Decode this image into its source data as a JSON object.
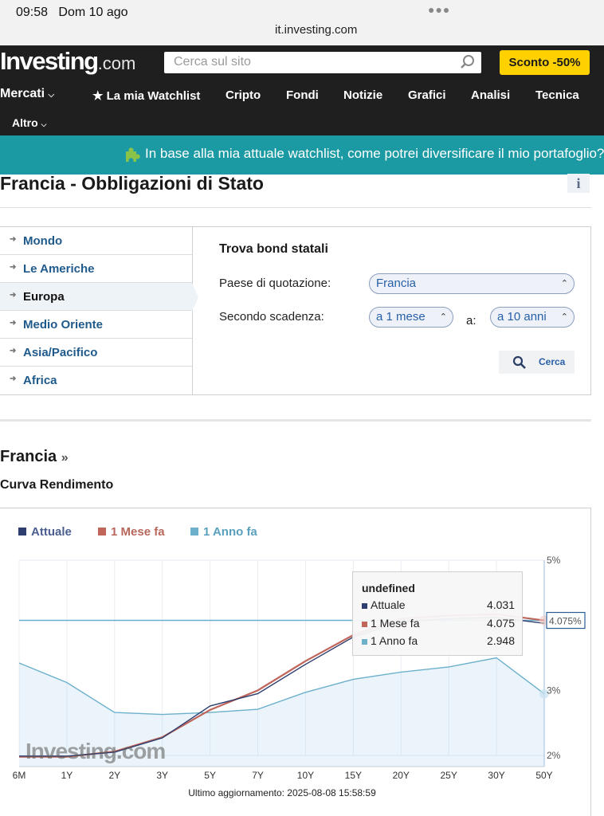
{
  "status": {
    "time": "09:58",
    "date": "Dom 10 ago",
    "url": "it.investing.com"
  },
  "header": {
    "logo_main": "Investing",
    "logo_com": ".com",
    "search_placeholder": "Cerca sul sito",
    "promo": "Sconto -50%"
  },
  "nav": {
    "items": [
      "Mercati",
      "La mia Watchlist",
      "Cripto",
      "Fondi",
      "Notizie",
      "Grafici",
      "Analisi",
      "Tecnica",
      "Altro"
    ]
  },
  "banner": {
    "text": "In base alla mia attuale watchlist, come potrei diversificare il mio portafoglio?"
  },
  "page": {
    "title": "Francia - Obbligazioni di Stato",
    "info": "i"
  },
  "regions": [
    "Mondo",
    "Le Americhe",
    "Europa",
    "Medio Oriente",
    "Asia/Pacifico",
    "Africa"
  ],
  "active_region": "Europa",
  "finder": {
    "title": "Trova bond statali",
    "country_label": "Paese di quotazione:",
    "country_value": "Francia",
    "maturity_label": "Secondo scadenza:",
    "from_value": "a 1 mese",
    "to_label": "a:",
    "to_value": "a 10 anni",
    "search_button": "Cerca"
  },
  "section": {
    "title": "Francia",
    "title_suffix": "»",
    "subtitle": "Curva Rendimento"
  },
  "chart_data": {
    "type": "line",
    "categories": [
      "6M",
      "1Y",
      "2Y",
      "3Y",
      "5Y",
      "7Y",
      "10Y",
      "15Y",
      "20Y",
      "25Y",
      "30Y",
      "50Y"
    ],
    "series": [
      {
        "name": "Attuale",
        "color": "#2e3e6e",
        "values": [
          1.99,
          1.99,
          2.05,
          2.27,
          2.76,
          2.95,
          3.4,
          3.82,
          4.05,
          4.1,
          4.12,
          4.031
        ]
      },
      {
        "name": "1 Mese fa",
        "color": "#c0655a",
        "values": [
          1.98,
          1.98,
          2.06,
          2.28,
          2.7,
          3.0,
          3.45,
          3.85,
          4.1,
          4.15,
          4.17,
          4.075
        ]
      },
      {
        "name": "1 Anno fa",
        "color": "#6cb0cc",
        "values": [
          3.42,
          3.12,
          2.66,
          2.63,
          2.66,
          2.71,
          2.97,
          3.17,
          3.28,
          3.36,
          3.5,
          2.948
        ]
      }
    ],
    "ylim": [
      2,
      5
    ],
    "yticks": [
      "5%",
      "4%",
      "3%",
      "2%"
    ],
    "hline_value": 4.075,
    "current_label": "4.075%",
    "tooltip": {
      "title": "undefined",
      "rows": [
        {
          "name": "Attuale",
          "value": "4.031"
        },
        {
          "name": "1 Mese fa",
          "value": "4.075"
        },
        {
          "name": "1 Anno fa",
          "value": "2.948"
        }
      ]
    },
    "watermark": "Investing.com",
    "updated": "Ultimo aggiornamento: 2025-08-08 15:58:59"
  }
}
